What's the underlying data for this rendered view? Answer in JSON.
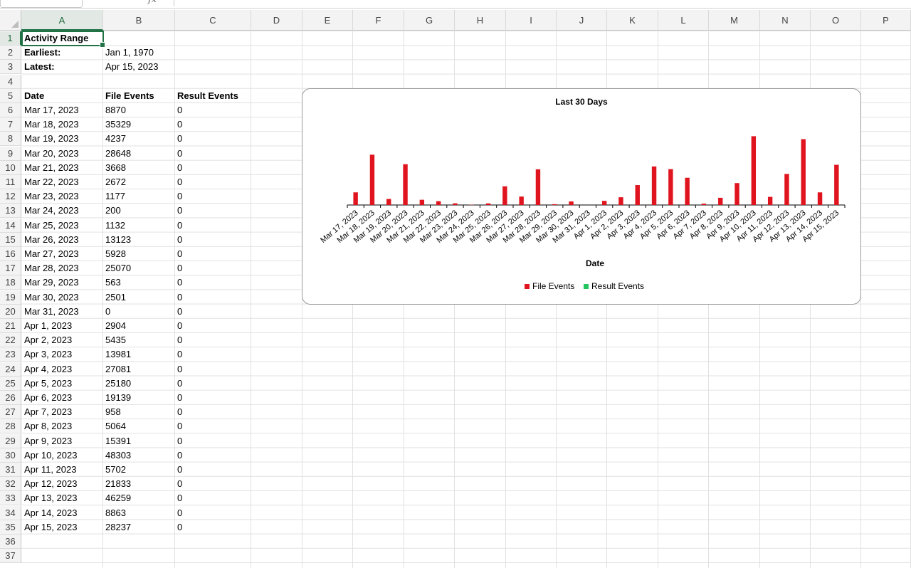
{
  "columns": [
    "A",
    "B",
    "C",
    "D",
    "E",
    "F",
    "G",
    "H",
    "I",
    "J",
    "K",
    "L",
    "M",
    "N",
    "O",
    "P"
  ],
  "rows": [
    "1",
    "2",
    "3",
    "4",
    "5",
    "6",
    "7",
    "8",
    "9",
    "10",
    "11",
    "12",
    "13",
    "14",
    "15",
    "16",
    "17",
    "18",
    "19",
    "20",
    "21",
    "22",
    "23",
    "24",
    "25",
    "26",
    "27",
    "28",
    "29",
    "30",
    "31",
    "32",
    "33",
    "34",
    "35",
    "36",
    "37"
  ],
  "sheet": {
    "title": "Activity Range",
    "earliest_label": "Earliest:",
    "earliest_value": "Jan 1, 1970",
    "latest_label": "Latest:",
    "latest_value": "Apr 15, 2023",
    "headers": [
      "Date",
      "File Events",
      "Result Events"
    ],
    "data": [
      [
        "Mar 17, 2023",
        "8870",
        "0"
      ],
      [
        "Mar 18, 2023",
        "35329",
        "0"
      ],
      [
        "Mar 19, 2023",
        "4237",
        "0"
      ],
      [
        "Mar 20, 2023",
        "28648",
        "0"
      ],
      [
        "Mar 21, 2023",
        "3668",
        "0"
      ],
      [
        "Mar 22, 2023",
        "2672",
        "0"
      ],
      [
        "Mar 23, 2023",
        "1177",
        "0"
      ],
      [
        "Mar 24, 2023",
        "200",
        "0"
      ],
      [
        "Mar 25, 2023",
        "1132",
        "0"
      ],
      [
        "Mar 26, 2023",
        "13123",
        "0"
      ],
      [
        "Mar 27, 2023",
        "5928",
        "0"
      ],
      [
        "Mar 28, 2023",
        "25070",
        "0"
      ],
      [
        "Mar 29, 2023",
        "563",
        "0"
      ],
      [
        "Mar 30, 2023",
        "2501",
        "0"
      ],
      [
        "Mar 31, 2023",
        "0",
        "0"
      ],
      [
        "Apr 1, 2023",
        "2904",
        "0"
      ],
      [
        "Apr 2, 2023",
        "5435",
        "0"
      ],
      [
        "Apr 3, 2023",
        "13981",
        "0"
      ],
      [
        "Apr 4, 2023",
        "27081",
        "0"
      ],
      [
        "Apr 5, 2023",
        "25180",
        "0"
      ],
      [
        "Apr 6, 2023",
        "19139",
        "0"
      ],
      [
        "Apr 7, 2023",
        "958",
        "0"
      ],
      [
        "Apr 8, 2023",
        "5064",
        "0"
      ],
      [
        "Apr 9, 2023",
        "15391",
        "0"
      ],
      [
        "Apr 10, 2023",
        "48303",
        "0"
      ],
      [
        "Apr 11, 2023",
        "5702",
        "0"
      ],
      [
        "Apr 12, 2023",
        "21833",
        "0"
      ],
      [
        "Apr 13, 2023",
        "46259",
        "0"
      ],
      [
        "Apr 14, 2023",
        "8863",
        "0"
      ],
      [
        "Apr 15, 2023",
        "28237",
        "0"
      ]
    ]
  },
  "chart_data": {
    "type": "bar",
    "title": "Last 30 Days",
    "xlabel": "Date",
    "ylabel": "",
    "legend_position": "bottom",
    "grid": false,
    "categories": [
      "Mar 17, 2023",
      "Mar 18, 2023",
      "Mar 19, 2023",
      "Mar 20, 2023",
      "Mar 21, 2023",
      "Mar 22, 2023",
      "Mar 23, 2023",
      "Mar 24, 2023",
      "Mar 25, 2023",
      "Mar 26, 2023",
      "Mar 27, 2023",
      "Mar 28, 2023",
      "Mar 29, 2023",
      "Mar 30, 2023",
      "Mar 31, 2023",
      "Apr 1, 2023",
      "Apr 2, 2023",
      "Apr 3, 2023",
      "Apr 4, 2023",
      "Apr 5, 2023",
      "Apr 6, 2023",
      "Apr 7, 2023",
      "Apr 8, 2023",
      "Apr 9, 2023",
      "Apr 10, 2023",
      "Apr 11, 2023",
      "Apr 12, 2023",
      "Apr 13, 2023",
      "Apr 14, 2023",
      "Apr 15, 2023"
    ],
    "series": [
      {
        "name": "File Events",
        "color": "#e0141e",
        "values": [
          8870,
          35329,
          4237,
          28648,
          3668,
          2672,
          1177,
          200,
          1132,
          13123,
          5928,
          25070,
          563,
          2501,
          0,
          2904,
          5435,
          13981,
          27081,
          25180,
          19139,
          958,
          5064,
          15391,
          48303,
          5702,
          21833,
          46259,
          8863,
          28237
        ]
      },
      {
        "name": "Result Events",
        "color": "#22c55e",
        "values": [
          0,
          0,
          0,
          0,
          0,
          0,
          0,
          0,
          0,
          0,
          0,
          0,
          0,
          0,
          0,
          0,
          0,
          0,
          0,
          0,
          0,
          0,
          0,
          0,
          0,
          0,
          0,
          0,
          0,
          0
        ]
      }
    ],
    "ylim": [
      0,
      50000
    ]
  }
}
